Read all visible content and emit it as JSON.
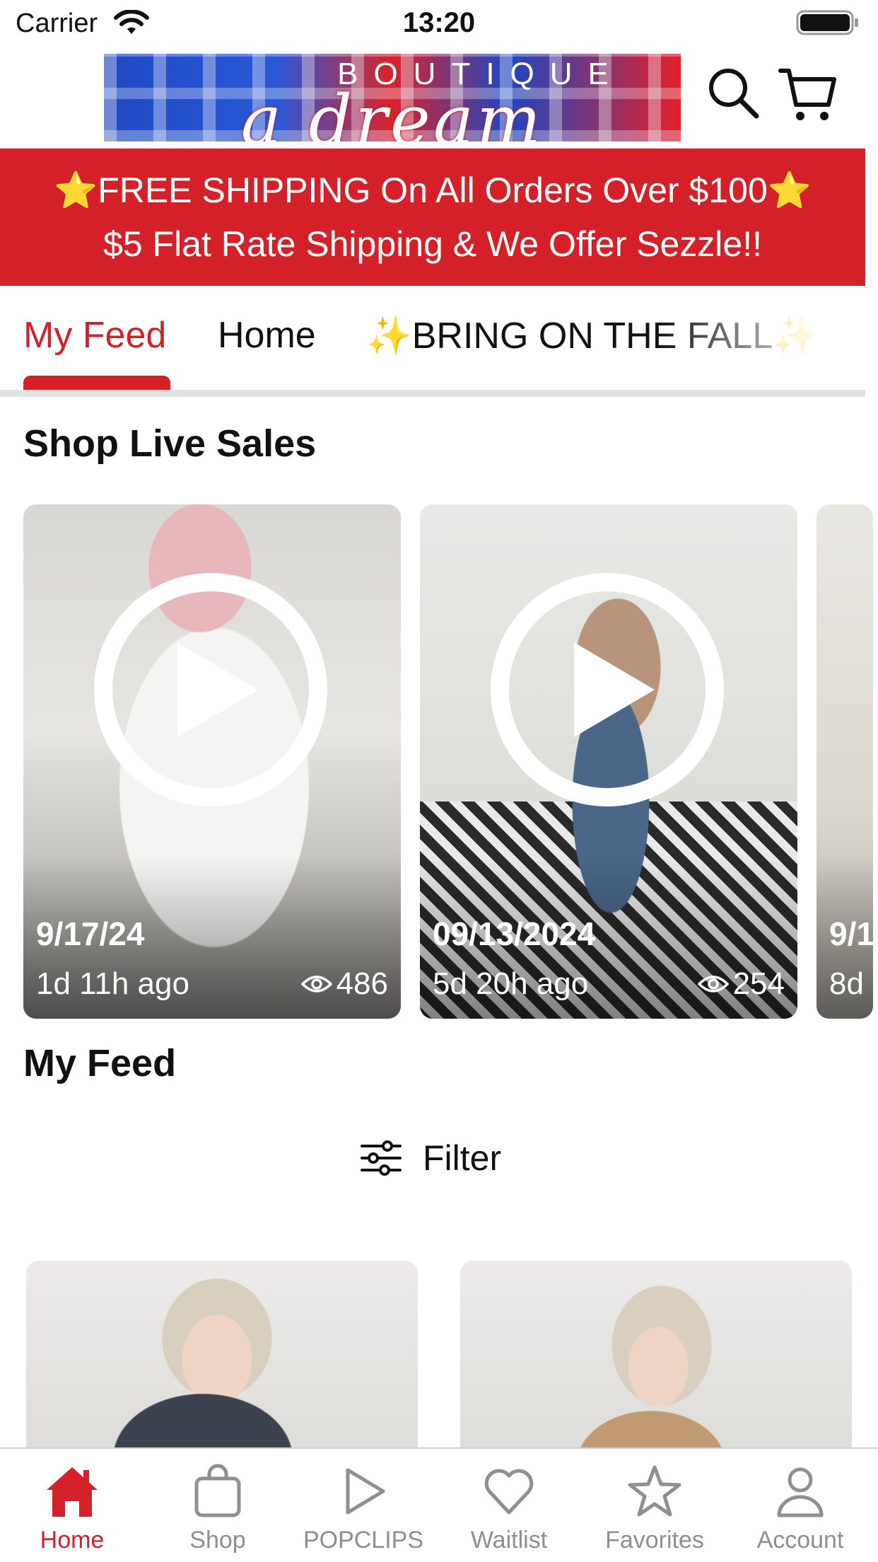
{
  "status_bar": {
    "carrier": "Carrier",
    "time": "13:20"
  },
  "header": {
    "logo_top": "BOUTIQUE",
    "logo_script": "a dream"
  },
  "promo": {
    "line1": "⭐FREE SHIPPING On All Orders Over $100⭐",
    "line2": "$5 Flat Rate Shipping & We Offer Sezzle!!"
  },
  "tabs": [
    {
      "label": "My Feed"
    },
    {
      "label": "Home"
    },
    {
      "label": "✨BRING ON THE FALL✨"
    }
  ],
  "live_sales": {
    "title": "Shop Live Sales",
    "cards": [
      {
        "date": "9/17/24",
        "ago": "1d 11h ago",
        "views": "486"
      },
      {
        "date": "09/13/2024",
        "ago": "5d 20h ago",
        "views": "254"
      },
      {
        "date": "9/1",
        "ago": "8d"
      }
    ]
  },
  "feed": {
    "title": "My Feed",
    "filter_label": "Filter"
  },
  "tabbar": [
    {
      "label": "Home"
    },
    {
      "label": "Shop"
    },
    {
      "label": "POPCLIPS"
    },
    {
      "label": "Waitlist"
    },
    {
      "label": "Favorites"
    },
    {
      "label": "Account"
    }
  ],
  "colors": {
    "accent": "#d42129",
    "inactive": "#8e8e93"
  }
}
